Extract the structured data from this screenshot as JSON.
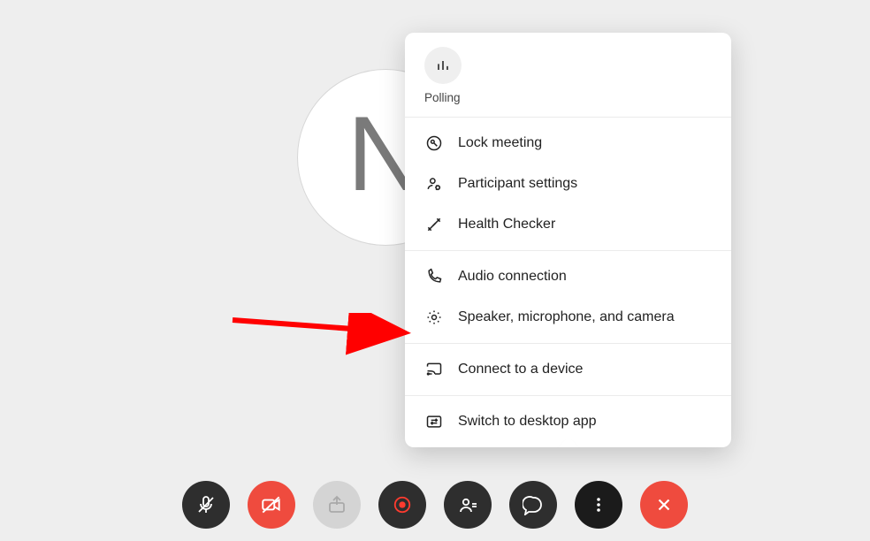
{
  "avatar": {
    "letter": "N"
  },
  "menu": {
    "polling_label": "Polling",
    "groups": [
      [
        {
          "id": "lock-meeting",
          "label": "Lock meeting"
        },
        {
          "id": "participant-settings",
          "label": "Participant settings"
        },
        {
          "id": "health-checker",
          "label": "Health Checker"
        }
      ],
      [
        {
          "id": "audio-connection",
          "label": "Audio connection"
        },
        {
          "id": "speaker-mic-camera",
          "label": "Speaker, microphone, and camera"
        }
      ],
      [
        {
          "id": "connect-device",
          "label": "Connect to a device"
        }
      ],
      [
        {
          "id": "switch-desktop",
          "label": "Switch to desktop app"
        }
      ]
    ]
  },
  "toolbar": {
    "mute": {
      "name": "mute-button"
    },
    "video": {
      "name": "video-off-button"
    },
    "share": {
      "name": "share-button"
    },
    "record": {
      "name": "record-button"
    },
    "participants": {
      "name": "participants-button"
    },
    "chat": {
      "name": "chat-button"
    },
    "more": {
      "name": "more-options-button"
    },
    "leave": {
      "name": "leave-button"
    }
  },
  "annotation": {
    "target": "speaker-mic-camera"
  }
}
